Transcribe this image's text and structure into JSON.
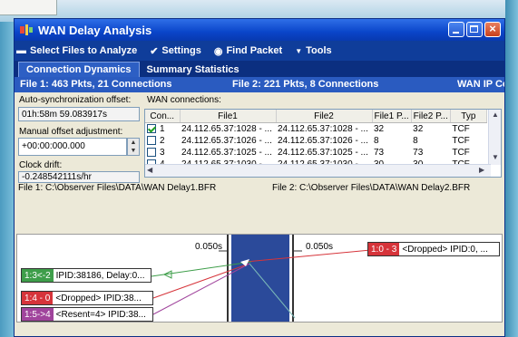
{
  "window": {
    "title": "WAN Delay Analysis"
  },
  "menu": {
    "select_files": "Select Files to Analyze",
    "settings": "Settings",
    "find_packet": "Find Packet",
    "tools": "Tools"
  },
  "tabs": [
    "Connection Dynamics",
    "Summary Statistics"
  ],
  "status": {
    "file1": "File 1: 463 Pkts,  21 Connections",
    "file2": "File 2: 221 Pkts,   8 Connections",
    "wan": "WAN IP Con"
  },
  "controls": {
    "auto_sync_label": "Auto-synchronization offset:",
    "auto_sync_value": "01h:58m 59.083917s",
    "manual_offset_label": "Manual offset adjustment:",
    "manual_offset_value": "+00:00:000.000",
    "clock_drift_label": "Clock drift:",
    "clock_drift_value": "-0.248542111s/hr"
  },
  "wan_connections": {
    "label": "WAN connections:",
    "columns": [
      "Con...",
      "File1",
      "File2",
      "File1 P...",
      "File2 P...",
      "Typ"
    ],
    "rows": [
      {
        "num": "1",
        "checked": true,
        "file1": "24.112.65.37:1028 - ...",
        "file2": "24.112.65.37:1028 - ...",
        "p1": "32",
        "p2": "32",
        "type": "TCF"
      },
      {
        "num": "2",
        "checked": false,
        "file1": "24.112.65.37:1026 - ...",
        "file2": "24.112.65.37:1026 - ...",
        "p1": "8",
        "p2": "8",
        "type": "TCF"
      },
      {
        "num": "3",
        "checked": false,
        "file1": "24.112.65.37:1025 - ...",
        "file2": "24.112.65.37:1025 - ...",
        "p1": "73",
        "p2": "73",
        "type": "TCF"
      },
      {
        "num": "4",
        "checked": false,
        "file1": "24.112.65.37:1030 - ...",
        "file2": "24.112.65.37:1030 - ...",
        "p1": "30",
        "p2": "30",
        "type": "TCF"
      }
    ]
  },
  "files": {
    "file1": "File 1: C:\\Observer Files\\DATA\\WAN Delay1.BFR",
    "file2": "File 2: C:\\Observer Files\\DATA\\WAN Delay2.BFR"
  },
  "ladder": {
    "left_tick": "0.050s",
    "right_tick": "0.050s",
    "packets_left": [
      {
        "id": "1:3<-2",
        "text": "IPID:38186, Delay:0...",
        "color": "#3e9e4a"
      },
      {
        "id": "1:4 - 0",
        "text": "<Dropped> IPID:38...",
        "color": "#d6343a"
      },
      {
        "id": "1:5->4",
        "text": "<Resent=4> IPID:38...",
        "color": "#a0449c"
      }
    ],
    "packets_right": [
      {
        "id": "1:0 - 3",
        "text": "<Dropped> IPID:0, ...",
        "color": "#d6343a"
      }
    ]
  },
  "colors": {
    "titlebar": "#0a45c9",
    "menubar": "#0f3d9a",
    "statusbar": "#2a5bc0",
    "wan_band": "#2b4a9a"
  }
}
